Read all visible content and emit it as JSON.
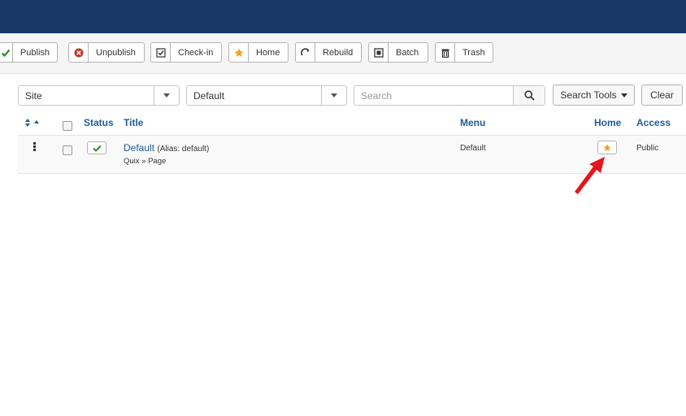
{
  "toolbar": {
    "publish": "Publish",
    "unpublish": "Unpublish",
    "checkin": "Check-in",
    "home": "Home",
    "rebuild": "Rebuild",
    "batch": "Batch",
    "trash": "Trash"
  },
  "filters": {
    "client": "Site",
    "menu": "Default",
    "search_placeholder": "Search",
    "search_tools": "Search Tools",
    "clear": "Clear"
  },
  "table": {
    "headers": {
      "status": "Status",
      "title": "Title",
      "menu": "Menu",
      "home": "Home",
      "access": "Access"
    },
    "rows": [
      {
        "title": "Default",
        "alias": "(Alias: default)",
        "sub": "Quix » Page",
        "menu": "Default",
        "access": "Public"
      }
    ]
  },
  "colors": {
    "topbar": "#1a3867",
    "link": "#1f5c99",
    "star": "#f0a020",
    "check": "#2c8a2c",
    "unpublish": "#c0392b",
    "arrow": "#e8141c"
  },
  "icons": [
    "check-icon",
    "unpublish-icon",
    "checkin-icon",
    "star-icon",
    "rebuild-icon",
    "batch-icon",
    "trash-icon",
    "search-icon",
    "caret-icon",
    "sort-icon",
    "drag-handle-icon",
    "arrow-pointer-icon"
  ]
}
